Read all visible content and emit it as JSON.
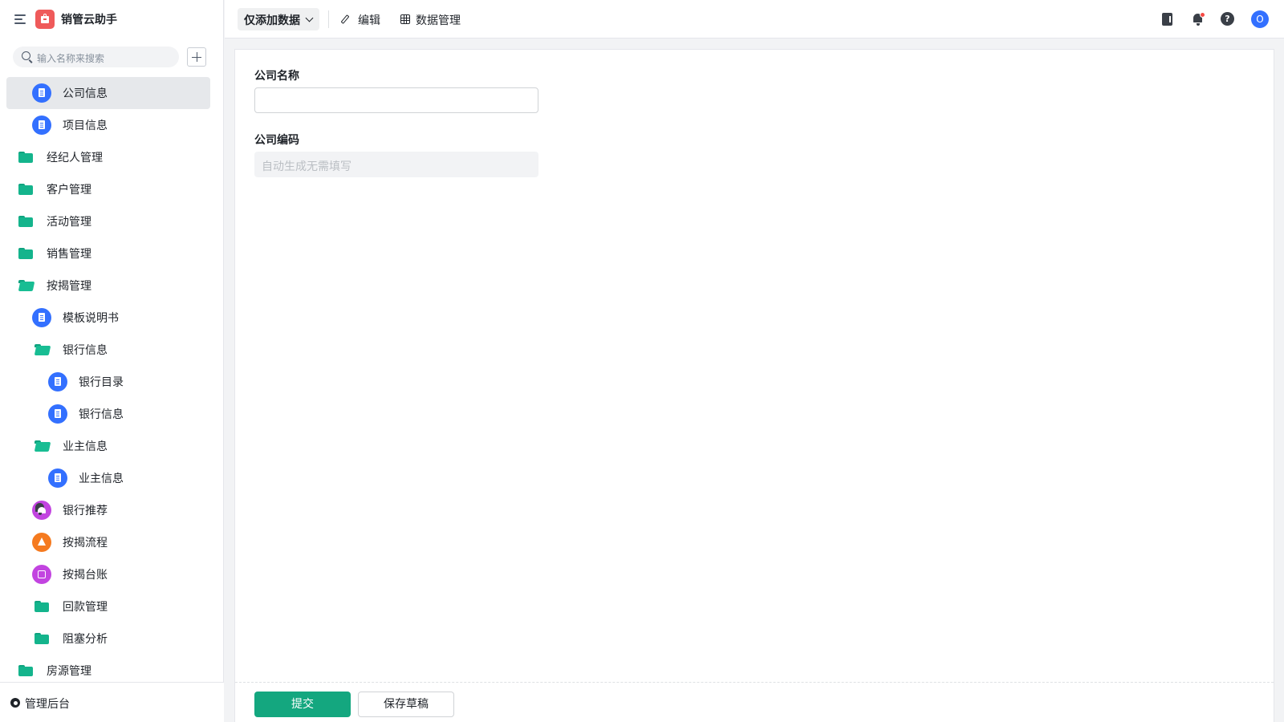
{
  "app": {
    "name": "销管云助手"
  },
  "sidebar": {
    "search_placeholder": "输入名称来搜索",
    "items": [
      {
        "label": "公司信息",
        "icon": "document-icon",
        "active": true
      },
      {
        "label": "项目信息",
        "icon": "document-icon"
      },
      {
        "label": "经纪人管理",
        "icon": "folder-icon"
      },
      {
        "label": "客户管理",
        "icon": "folder-icon"
      },
      {
        "label": "活动管理",
        "icon": "folder-icon"
      },
      {
        "label": "销售管理",
        "icon": "folder-icon"
      },
      {
        "label": "按揭管理",
        "icon": "folder-open-icon"
      },
      {
        "label": "模板说明书",
        "icon": "document-icon"
      },
      {
        "label": "银行信息",
        "icon": "folder-open-icon"
      },
      {
        "label": "银行目录",
        "icon": "document-icon"
      },
      {
        "label": "银行信息",
        "icon": "document-icon"
      },
      {
        "label": "业主信息",
        "icon": "folder-open-icon"
      },
      {
        "label": "业主信息",
        "icon": "document-icon"
      },
      {
        "label": "银行推荐",
        "icon": "bot-icon",
        "color": "#c244e0"
      },
      {
        "label": "按揭流程",
        "icon": "flow-icon",
        "color": "#f57a1f"
      },
      {
        "label": "按揭台账",
        "icon": "dashboard-icon",
        "color": "#c244e0"
      },
      {
        "label": "回款管理",
        "icon": "folder-icon"
      },
      {
        "label": "阻塞分析",
        "icon": "folder-icon"
      },
      {
        "label": "房源管理",
        "icon": "folder-icon"
      }
    ],
    "footer_label": "管理后台"
  },
  "toolbar": {
    "mode_label": "仅添加数据",
    "edit_label": "编辑",
    "data_label": "数据管理",
    "help_glyph": "?",
    "avatar_initial": "O"
  },
  "form": {
    "fields": [
      {
        "label": "公司名称",
        "value": "",
        "placeholder": ""
      },
      {
        "label": "公司编码",
        "value": "",
        "placeholder": "自动生成无需填写",
        "disabled": true
      }
    ],
    "submit_label": "提交",
    "draft_label": "保存草稿"
  },
  "colors": {
    "primary": "#14a77f",
    "accent_blue": "#3370ff",
    "folder_green": "#14b48c",
    "logo_red": "#ef5a5a"
  }
}
